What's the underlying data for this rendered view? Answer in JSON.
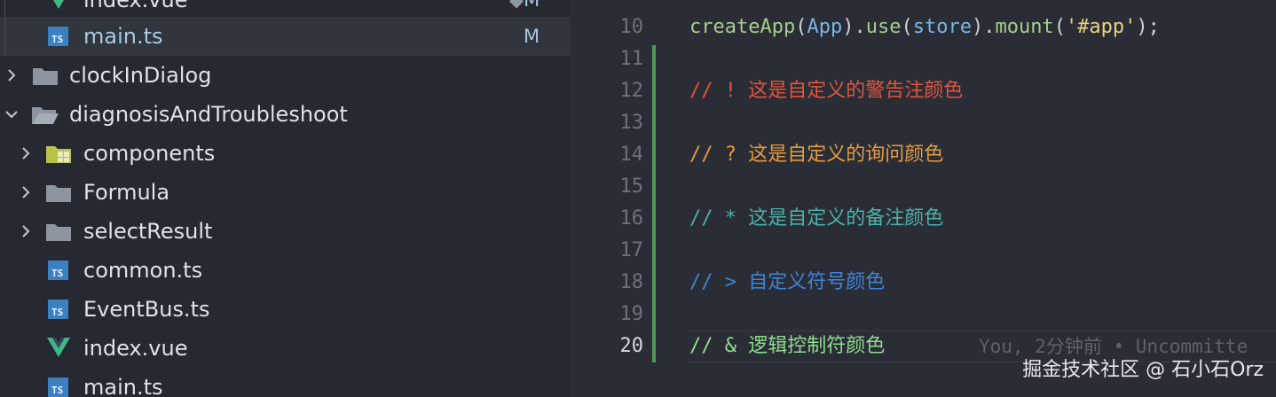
{
  "explorer": {
    "items": [
      {
        "label": "index.vue",
        "type": "vue",
        "git": "M"
      },
      {
        "label": "main.ts",
        "type": "ts",
        "git": "M",
        "selected": true
      },
      {
        "label": "clockInDialog",
        "type": "folder",
        "collapsed": true
      },
      {
        "label": "diagnosisAndTroubleshoot",
        "type": "folder-open",
        "expanded": true
      },
      {
        "label": "components",
        "type": "folder-components",
        "collapsed": true
      },
      {
        "label": "Formula",
        "type": "folder",
        "collapsed": true
      },
      {
        "label": "selectResult",
        "type": "folder",
        "collapsed": true
      },
      {
        "label": "common.ts",
        "type": "ts"
      },
      {
        "label": "EventBus.ts",
        "type": "ts"
      },
      {
        "label": "index.vue",
        "type": "vue"
      },
      {
        "label": "main.ts",
        "type": "ts"
      }
    ],
    "ts_badge": "TS"
  },
  "editor": {
    "line_numbers": [
      "10",
      "11",
      "12",
      "13",
      "14",
      "15",
      "16",
      "17",
      "18",
      "19",
      "20"
    ],
    "active_line": "20",
    "line10": {
      "fn1": "createApp",
      "p1": "(",
      "id1": "App",
      "p2": ").",
      "fn2": "use",
      "p3": "(",
      "id2": "store",
      "p4": ").",
      "fn3": "mount",
      "p5": "(",
      "str": "'#app'",
      "p6": ");"
    },
    "comments": [
      {
        "prefix": "// ! ",
        "text": "这是自定义的警告注颜色",
        "color": "#e0553e"
      },
      {
        "prefix": "// ? ",
        "text": "这是自定义的询问颜色",
        "color": "#e59a3f"
      },
      {
        "prefix": "// * ",
        "text": "这是自定义的备注颜色",
        "color": "#4bb0a9"
      },
      {
        "prefix": "// > ",
        "text": "自定义符号颜色",
        "color": "#3e84d6"
      },
      {
        "prefix": "// & ",
        "text": "逻辑控制符颜色",
        "color": "#8fdc8f"
      }
    ],
    "blame": "You, 2分钟前 • Uncommitte"
  },
  "watermark": "掘金技术社区 @ 石小石Orz"
}
